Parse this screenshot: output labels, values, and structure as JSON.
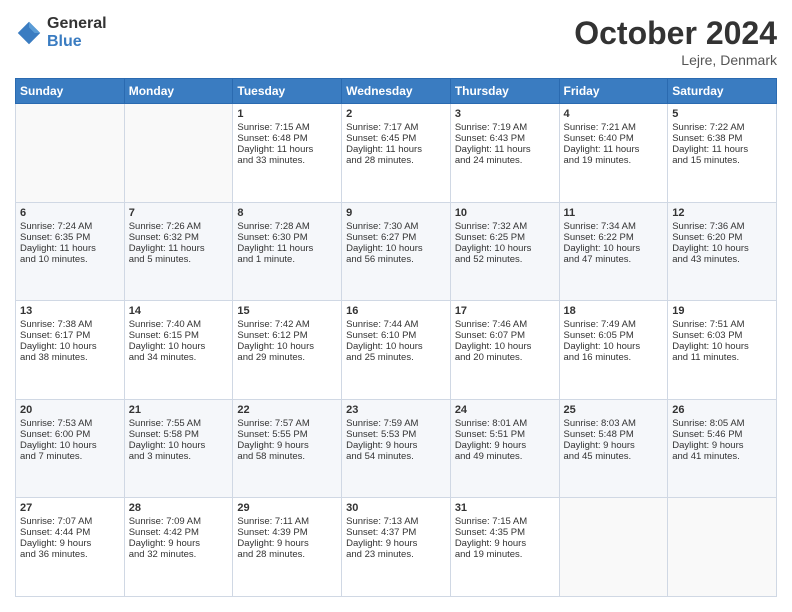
{
  "logo": {
    "general": "General",
    "blue": "Blue"
  },
  "header": {
    "month": "October 2024",
    "location": "Lejre, Denmark"
  },
  "days_of_week": [
    "Sunday",
    "Monday",
    "Tuesday",
    "Wednesday",
    "Thursday",
    "Friday",
    "Saturday"
  ],
  "weeks": [
    [
      {
        "day": "",
        "content": ""
      },
      {
        "day": "",
        "content": ""
      },
      {
        "day": "1",
        "content": "Sunrise: 7:15 AM\nSunset: 6:48 PM\nDaylight: 11 hours\nand 33 minutes."
      },
      {
        "day": "2",
        "content": "Sunrise: 7:17 AM\nSunset: 6:45 PM\nDaylight: 11 hours\nand 28 minutes."
      },
      {
        "day": "3",
        "content": "Sunrise: 7:19 AM\nSunset: 6:43 PM\nDaylight: 11 hours\nand 24 minutes."
      },
      {
        "day": "4",
        "content": "Sunrise: 7:21 AM\nSunset: 6:40 PM\nDaylight: 11 hours\nand 19 minutes."
      },
      {
        "day": "5",
        "content": "Sunrise: 7:22 AM\nSunset: 6:38 PM\nDaylight: 11 hours\nand 15 minutes."
      }
    ],
    [
      {
        "day": "6",
        "content": "Sunrise: 7:24 AM\nSunset: 6:35 PM\nDaylight: 11 hours\nand 10 minutes."
      },
      {
        "day": "7",
        "content": "Sunrise: 7:26 AM\nSunset: 6:32 PM\nDaylight: 11 hours\nand 5 minutes."
      },
      {
        "day": "8",
        "content": "Sunrise: 7:28 AM\nSunset: 6:30 PM\nDaylight: 11 hours\nand 1 minute."
      },
      {
        "day": "9",
        "content": "Sunrise: 7:30 AM\nSunset: 6:27 PM\nDaylight: 10 hours\nand 56 minutes."
      },
      {
        "day": "10",
        "content": "Sunrise: 7:32 AM\nSunset: 6:25 PM\nDaylight: 10 hours\nand 52 minutes."
      },
      {
        "day": "11",
        "content": "Sunrise: 7:34 AM\nSunset: 6:22 PM\nDaylight: 10 hours\nand 47 minutes."
      },
      {
        "day": "12",
        "content": "Sunrise: 7:36 AM\nSunset: 6:20 PM\nDaylight: 10 hours\nand 43 minutes."
      }
    ],
    [
      {
        "day": "13",
        "content": "Sunrise: 7:38 AM\nSunset: 6:17 PM\nDaylight: 10 hours\nand 38 minutes."
      },
      {
        "day": "14",
        "content": "Sunrise: 7:40 AM\nSunset: 6:15 PM\nDaylight: 10 hours\nand 34 minutes."
      },
      {
        "day": "15",
        "content": "Sunrise: 7:42 AM\nSunset: 6:12 PM\nDaylight: 10 hours\nand 29 minutes."
      },
      {
        "day": "16",
        "content": "Sunrise: 7:44 AM\nSunset: 6:10 PM\nDaylight: 10 hours\nand 25 minutes."
      },
      {
        "day": "17",
        "content": "Sunrise: 7:46 AM\nSunset: 6:07 PM\nDaylight: 10 hours\nand 20 minutes."
      },
      {
        "day": "18",
        "content": "Sunrise: 7:49 AM\nSunset: 6:05 PM\nDaylight: 10 hours\nand 16 minutes."
      },
      {
        "day": "19",
        "content": "Sunrise: 7:51 AM\nSunset: 6:03 PM\nDaylight: 10 hours\nand 11 minutes."
      }
    ],
    [
      {
        "day": "20",
        "content": "Sunrise: 7:53 AM\nSunset: 6:00 PM\nDaylight: 10 hours\nand 7 minutes."
      },
      {
        "day": "21",
        "content": "Sunrise: 7:55 AM\nSunset: 5:58 PM\nDaylight: 10 hours\nand 3 minutes."
      },
      {
        "day": "22",
        "content": "Sunrise: 7:57 AM\nSunset: 5:55 PM\nDaylight: 9 hours\nand 58 minutes."
      },
      {
        "day": "23",
        "content": "Sunrise: 7:59 AM\nSunset: 5:53 PM\nDaylight: 9 hours\nand 54 minutes."
      },
      {
        "day": "24",
        "content": "Sunrise: 8:01 AM\nSunset: 5:51 PM\nDaylight: 9 hours\nand 49 minutes."
      },
      {
        "day": "25",
        "content": "Sunrise: 8:03 AM\nSunset: 5:48 PM\nDaylight: 9 hours\nand 45 minutes."
      },
      {
        "day": "26",
        "content": "Sunrise: 8:05 AM\nSunset: 5:46 PM\nDaylight: 9 hours\nand 41 minutes."
      }
    ],
    [
      {
        "day": "27",
        "content": "Sunrise: 7:07 AM\nSunset: 4:44 PM\nDaylight: 9 hours\nand 36 minutes."
      },
      {
        "day": "28",
        "content": "Sunrise: 7:09 AM\nSunset: 4:42 PM\nDaylight: 9 hours\nand 32 minutes."
      },
      {
        "day": "29",
        "content": "Sunrise: 7:11 AM\nSunset: 4:39 PM\nDaylight: 9 hours\nand 28 minutes."
      },
      {
        "day": "30",
        "content": "Sunrise: 7:13 AM\nSunset: 4:37 PM\nDaylight: 9 hours\nand 23 minutes."
      },
      {
        "day": "31",
        "content": "Sunrise: 7:15 AM\nSunset: 4:35 PM\nDaylight: 9 hours\nand 19 minutes."
      },
      {
        "day": "",
        "content": ""
      },
      {
        "day": "",
        "content": ""
      }
    ]
  ]
}
